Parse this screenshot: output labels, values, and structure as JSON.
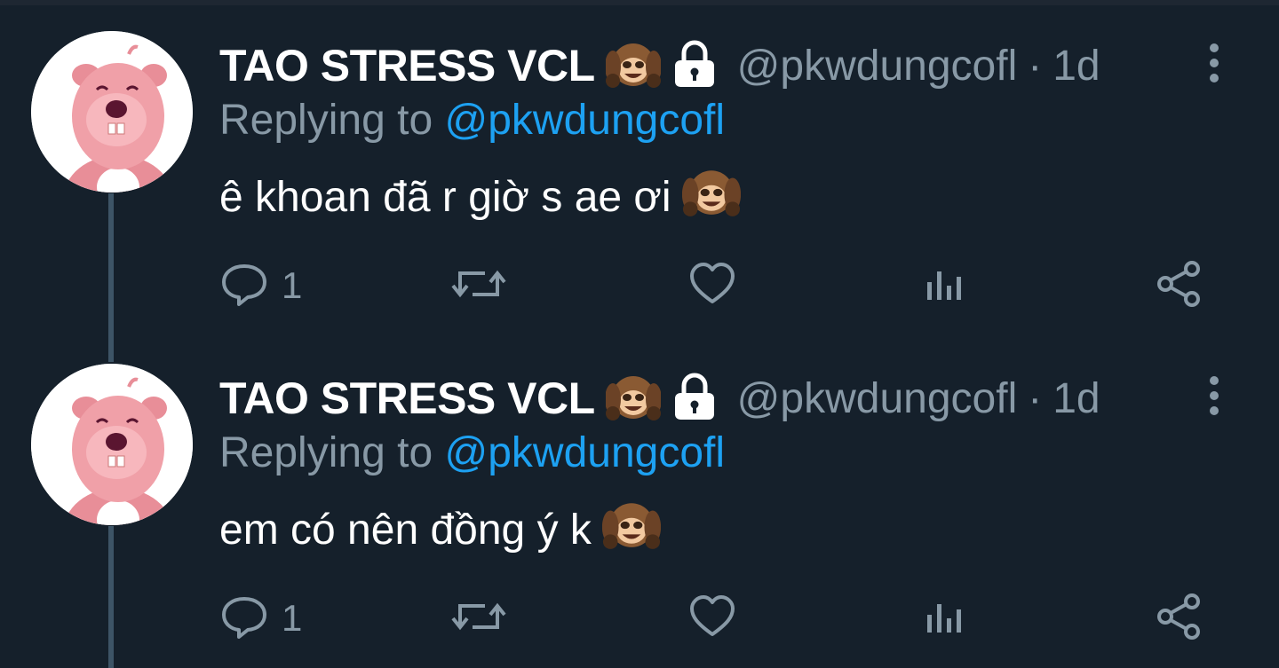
{
  "tweets": [
    {
      "user": {
        "display_name": "TAO STRESS VCL",
        "handle": "@pkwdungcofl",
        "emoji_icon": "see-no-evil-monkey",
        "locked_icon": "lock"
      },
      "separator": "·",
      "time": "1d",
      "replying_prefix": "Replying to",
      "replying_to": "@pkwdungcofl",
      "text": "ê khoan đã r giờ s ae ơi",
      "reply_count": "1"
    },
    {
      "user": {
        "display_name": "TAO STRESS VCL",
        "handle": "@pkwdungcofl",
        "emoji_icon": "see-no-evil-monkey",
        "locked_icon": "lock"
      },
      "separator": "·",
      "time": "1d",
      "replying_prefix": "Replying to",
      "replying_to": "@pkwdungcofl",
      "text": "em có nên đồng ý k",
      "reply_count": "1"
    }
  ],
  "colors": {
    "background": "#15202b",
    "secondary_text": "#8899a6",
    "link": "#1da1f2",
    "thread_line": "#3d5466",
    "avatar_pink": "#f0a0a8"
  },
  "icons": [
    "kebab-menu-icon",
    "reply-icon",
    "retweet-icon",
    "like-icon",
    "stats-icon",
    "share-icon",
    "lock-icon",
    "monkey-emoji-icon"
  ]
}
